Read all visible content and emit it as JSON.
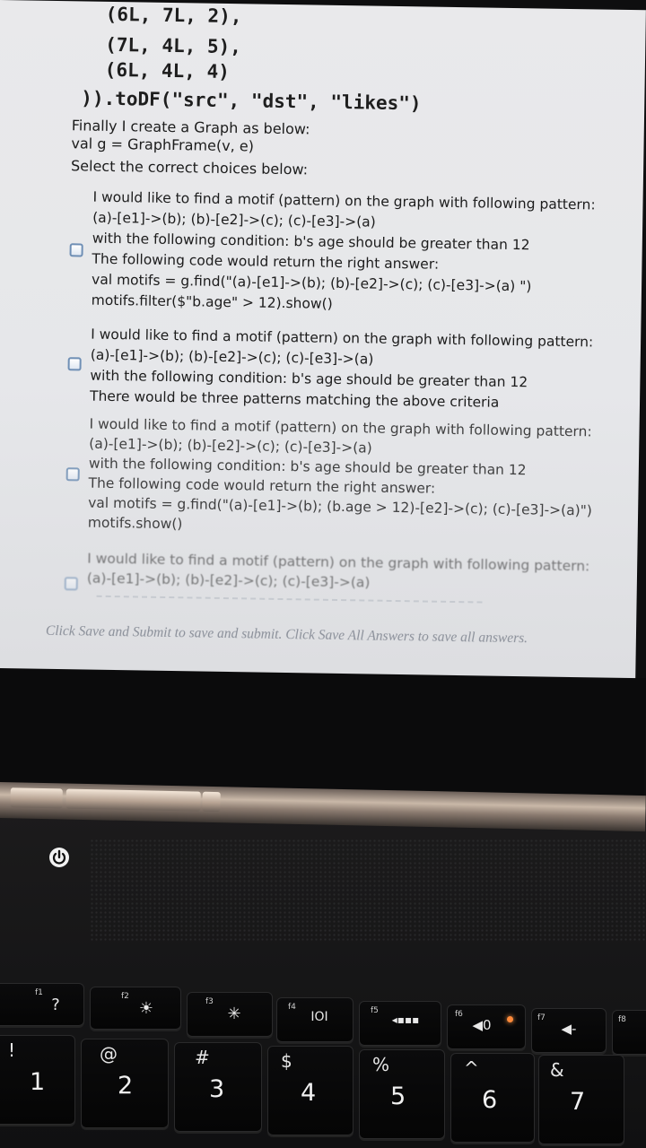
{
  "code_lines": [
    "(6L, 7L, 2),",
    "(7L, 4L, 5),",
    "(6L, 4L, 4)",
    ")).toDF(\"src\", \"dst\", \"likes\")"
  ],
  "intro": {
    "line1": "Finally I create a Graph as below:",
    "line2": "val g = GraphFrame(v, e)",
    "line3": "Select the correct choices below:"
  },
  "options": [
    {
      "lines": [
        "I would like to find a motif (pattern) on the graph with following pattern:",
        "(a)-[e1]->(b); (b)-[e2]->(c); (c)-[e3]->(a)",
        "with the following condition: b's age should be greater than 12",
        "The following code would return the right answer:",
        "val motifs = g.find(\"(a)-[e1]->(b); (b)-[e2]->(c); (c)-[e3]->(a) \")",
        "motifs.filter($\"b.age\" > 12).show()"
      ],
      "checked": false
    },
    {
      "lines": [
        "I would like to find a motif (pattern) on the graph with following pattern:",
        "(a)-[e1]->(b); (b)-[e2]->(c); (c)-[e3]->(a)",
        "with the following condition: b's age should be greater than 12",
        "There would be three patterns matching the above criteria"
      ],
      "checked": false
    },
    {
      "lines": [
        "I would like to find a motif (pattern) on the graph with following pattern:",
        "(a)-[e1]->(b); (b)-[e2]->(c); (c)-[e3]->(a)",
        "with the following condition: b's age should be greater than 12",
        "The following code would return the right answer:",
        "val motifs = g.find(\"(a)-[e1]->(b); (b.age > 12)-[e2]->(c); (c)-[e3]->(a)\")",
        "motifs.show()"
      ],
      "checked": false
    },
    {
      "lines": [
        "I would like to find a motif (pattern) on the graph with following pattern:",
        "(a)-[e1]->(b); (b)-[e2]->(c); (c)-[e3]->(a)"
      ],
      "checked": false
    }
  ],
  "footer": "Click Save and Submit to save and submit. Click Save All Answers to save all answers.",
  "keyboard": {
    "fn_keys": [
      {
        "label": "f1",
        "glyph": "?",
        "icon": "help-icon"
      },
      {
        "label": "f2",
        "glyph": "☀",
        "icon": "brightness-down-icon"
      },
      {
        "label": "f3",
        "glyph": "✳",
        "icon": "brightness-up-icon"
      },
      {
        "label": "f4",
        "glyph": "IOI",
        "icon": "display-switch-icon"
      },
      {
        "label": "f5",
        "glyph": "◂▪▪▪",
        "icon": "keyboard-backlight-icon"
      },
      {
        "label": "f6",
        "glyph": "◀0",
        "icon": "mute-icon"
      },
      {
        "label": "f7",
        "glyph": "◀-",
        "icon": "volume-down-icon"
      },
      {
        "label": "f8",
        "glyph": "",
        "icon": "volume-up-icon"
      }
    ],
    "num_keys": [
      {
        "top": "!",
        "main": "1"
      },
      {
        "top": "@",
        "main": "2"
      },
      {
        "top": "#",
        "main": "3"
      },
      {
        "top": "$",
        "main": "4"
      },
      {
        "top": "%",
        "main": "5"
      },
      {
        "top": "^",
        "main": "6"
      },
      {
        "top": "&",
        "main": "7"
      }
    ]
  },
  "colors": {
    "screen_bg": "#e7e8eb",
    "text": "#1c1c1c",
    "checkbox_border": "#6f8fb5",
    "footer_text": "#8a8f99",
    "led": "#ff8a3a"
  }
}
